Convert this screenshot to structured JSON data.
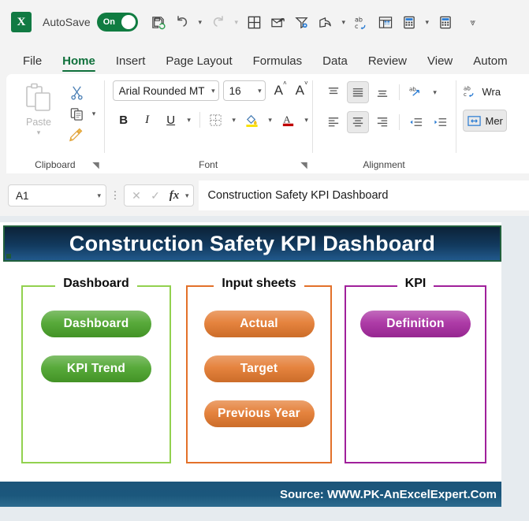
{
  "app": {
    "logo_text": "X",
    "autosave_label": "AutoSave",
    "autosave_state": "On"
  },
  "quick_access": {
    "items": [
      {
        "name": "save-icon",
        "tooltip": "Save"
      },
      {
        "name": "undo-icon",
        "tooltip": "Undo"
      },
      {
        "name": "redo-icon",
        "tooltip": "Redo"
      },
      {
        "name": "borders-icon",
        "tooltip": "Borders"
      },
      {
        "name": "email-icon",
        "tooltip": "Email"
      },
      {
        "name": "filter-settings-icon",
        "tooltip": "Custom Sort & Filter"
      },
      {
        "name": "share-icon",
        "tooltip": "Share"
      },
      {
        "name": "spelling-icon",
        "tooltip": "Spelling"
      },
      {
        "name": "pivot-table-icon",
        "tooltip": "PivotTable"
      },
      {
        "name": "calculate-icon",
        "tooltip": "Calculate Now"
      },
      {
        "name": "calculate-sheet-icon",
        "tooltip": "Calculate Sheet"
      },
      {
        "name": "customize-qat-icon",
        "tooltip": "Customize Quick Access Toolbar"
      }
    ]
  },
  "ribbon": {
    "tabs": [
      {
        "label": "File",
        "active": false
      },
      {
        "label": "Home",
        "active": true
      },
      {
        "label": "Insert",
        "active": false
      },
      {
        "label": "Page Layout",
        "active": false
      },
      {
        "label": "Formulas",
        "active": false
      },
      {
        "label": "Data",
        "active": false
      },
      {
        "label": "Review",
        "active": false
      },
      {
        "label": "View",
        "active": false
      },
      {
        "label": "Autom",
        "active": false
      }
    ],
    "clipboard": {
      "group_label": "Clipboard",
      "paste_label": "Paste"
    },
    "font": {
      "group_label": "Font",
      "font_name": "Arial Rounded MT",
      "font_size": "16",
      "bold_label": "B",
      "italic_label": "I",
      "underline_label": "U"
    },
    "alignment": {
      "group_label": "Alignment",
      "wrap_label": "Wra",
      "merge_label": "Mer"
    }
  },
  "formula_bar": {
    "name_box": "A1",
    "cancel_icon": "cancel-icon",
    "enter_icon": "confirm-icon",
    "fx_label": "fx",
    "content": "Construction Safety KPI Dashboard"
  },
  "worksheet": {
    "banner_title": "Construction Safety KPI Dashboard",
    "groups": [
      {
        "title": "Dashboard",
        "color": "#92d14f",
        "button_color": "#4aa32a",
        "buttons": [
          {
            "label": "Dashboard"
          },
          {
            "label": "KPI Trend"
          }
        ]
      },
      {
        "title": "Input sheets",
        "color": "#e3712a",
        "button_color": "#e3792e",
        "buttons": [
          {
            "label": "Actual"
          },
          {
            "label": "Target"
          },
          {
            "label": "Previous Year"
          }
        ]
      },
      {
        "title": "KPI",
        "color": "#a0209b",
        "button_color": "#a72ba0",
        "buttons": [
          {
            "label": "Definition"
          }
        ]
      }
    ],
    "footer_text": "Source: WWW.PK-AnExcelExpert.Com"
  }
}
